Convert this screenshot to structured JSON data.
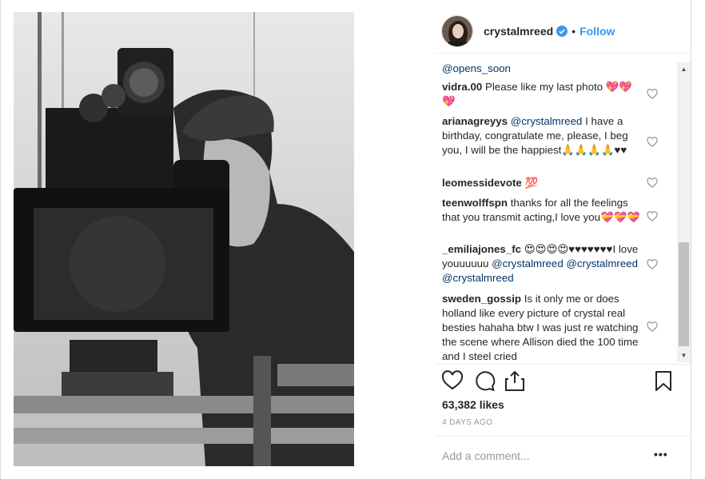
{
  "post": {
    "username": "crystalmreed",
    "dot": "•",
    "follow_label": "Follow",
    "likes": "63,382 likes",
    "time": "4 DAYS AGO",
    "add_comment_placeholder": "Add a comment...",
    "more_label": "•••"
  },
  "comments": [
    {
      "text_html": "<span class=\"mention\">@opens_soon</span>"
    },
    {
      "user": "vidra.00",
      "text": " Please like my last photo 💖💖💖"
    },
    {
      "user": "arianagreyys",
      "mention": " @crystalmreed",
      "text": " I have a birthday, congratulate me, please, I beg you, I will be the happiest🙏🙏🙏🙏♥♥"
    },
    {
      "user": "leomessidevote",
      "text": " 💯"
    },
    {
      "user": "teenwolffspn",
      "text": " thanks for all the feelings that you transmit acting,I love you💝💝💝"
    },
    {
      "user": "_emiliajones_fc",
      "text": " 😍😍😍😍♥♥♥♥♥♥♥I love youuuuuu ",
      "mentions": "@crystalmreed @crystalmreed @crystalmreed"
    },
    {
      "user": "sweden_gossip",
      "text": " Is it only me or does holland like every picture of crystal real besties hahaha btw I was just re watching the scene where Allison died the 100 time and I steel cried"
    }
  ],
  "icons": {
    "verified": "verified-badge-icon",
    "like": "heart-icon",
    "comment": "comment-bubble-icon",
    "share": "share-icon",
    "save": "bookmark-icon"
  },
  "colors": {
    "accent": "#3897f0",
    "mention": "#003569"
  }
}
